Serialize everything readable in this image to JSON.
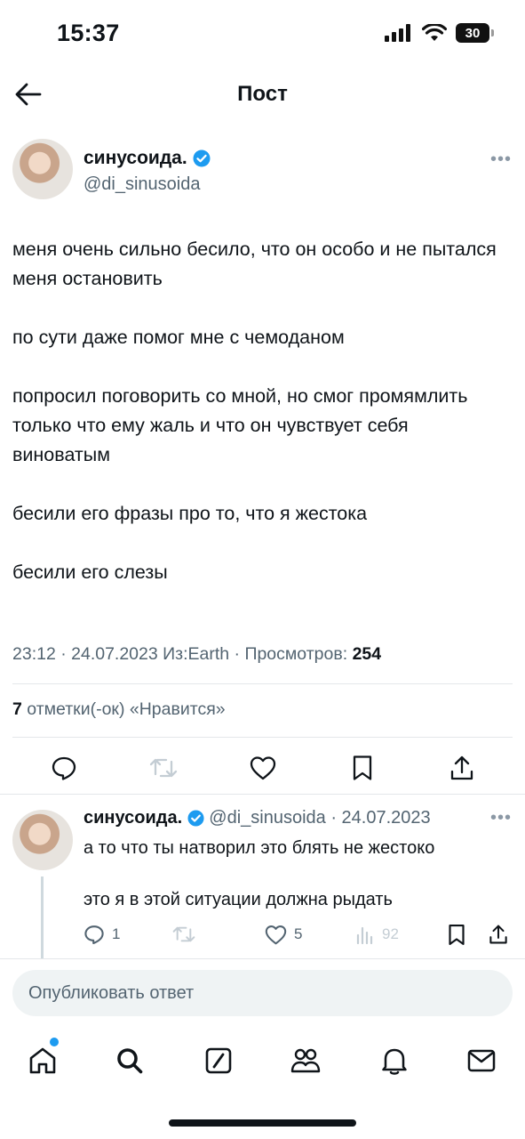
{
  "status_bar": {
    "time": "15:37",
    "battery": "30"
  },
  "header": {
    "title": "Пост"
  },
  "post": {
    "author_name": "синусоида.",
    "author_handle": "@di_sinusoida",
    "paragraphs": [
      "меня очень сильно бесило, что он особо и не пытался меня остановить",
      "по сути даже помог мне с чемоданом",
      "попросил поговорить со мной, но смог промямлить только что ему жаль и что он чувствует себя виноватым",
      "бесили его фразы про то, что я жестока",
      "бесили его слезы"
    ],
    "meta_prefix": "23:12 · 24.07.2023 Из:Earth · Просмотров:",
    "views": "254",
    "likes_count": "7",
    "likes_label": "отметки(-ок) «Нравится»"
  },
  "reply": {
    "author_name": "синусоида.",
    "handle_date": "@di_sinusoida · 24.07.2023",
    "paragraphs": [
      "а то что ты натворил это блять не жестоко",
      "это я в этой ситуации должна рыдать"
    ],
    "reply_count": "1",
    "like_count": "5",
    "view_count": "92"
  },
  "composer": {
    "placeholder": "Опубликовать ответ"
  },
  "colors": {
    "accent": "#1d9bf0",
    "text": "#0f1419",
    "secondary": "#536471",
    "divider": "#e4e7ea"
  },
  "icons": {
    "tabs": [
      "home-icon",
      "search-icon",
      "compose-icon",
      "communities-icon",
      "notifications-icon",
      "messages-icon"
    ],
    "actions": [
      "reply-icon",
      "repost-icon",
      "like-icon",
      "bookmark-icon",
      "share-icon"
    ]
  }
}
